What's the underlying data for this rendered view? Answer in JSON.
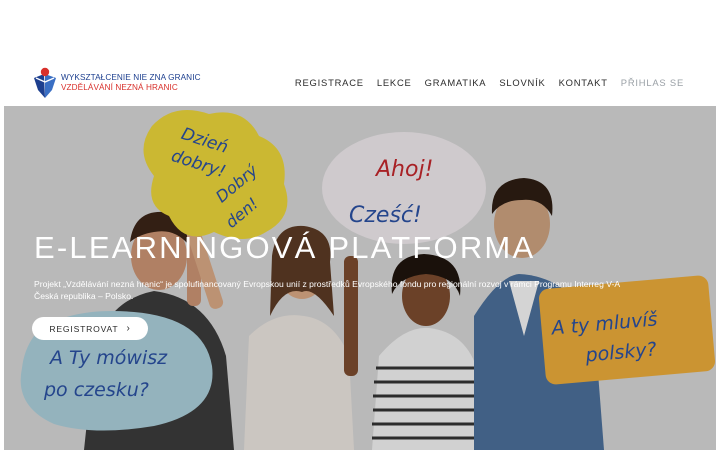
{
  "logo": {
    "line1": "WYKSZTAŁCENIE NIE ZNA GRANIC",
    "line2": "VZDĚLÁVÁNÍ NEZNÁ HRANIC"
  },
  "nav": {
    "items": [
      "REGISTRACE",
      "LEKCE",
      "GRAMATIKA",
      "SLOVNÍK",
      "KONTAKT"
    ],
    "login": "PŘIHLAS SE"
  },
  "hero": {
    "title": "E-LEARNINGOVÁ PLATFORMA",
    "text": "Projekt „Vzdělávání nezná hranic“ je spolufinancovaný Evropskou unií z prostředků Evropského fondu pro regionální rozvoj v rámci Programu Interreg V-A Česká republika – Polsko.",
    "button_label": "REGISTROVAT",
    "button_icon": "chevron-right-icon"
  },
  "signs": {
    "sign1": [
      "Dzień",
      "dobry!",
      "Dobrý",
      "den!"
    ],
    "sign2": [
      "Ahoj!",
      "Cześć!"
    ],
    "sign3": [
      "A Ty mówisz",
      "po czesku?"
    ],
    "sign4": [
      "A ty mluvíš",
      "polsky?"
    ]
  },
  "colors": {
    "brand_blue": "#1d3f8f",
    "brand_red": "#d8302b",
    "nav_text": "#2b2b2b",
    "nav_login": "#9aa0a6",
    "sign_yellow": "#e8d23a",
    "sign_orange": "#e8a93a",
    "sign_blue": "#9ec6d6"
  }
}
